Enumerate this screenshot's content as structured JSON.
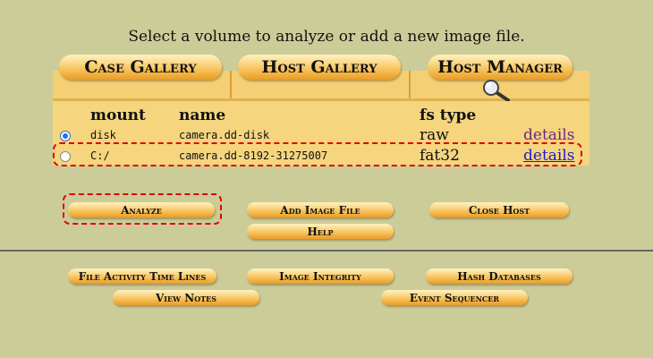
{
  "instruction": "Select a volume to analyze or add a new image file.",
  "tabs": {
    "case_gallery": "Case Gallery",
    "host_gallery": "Host Gallery",
    "host_manager": "Host Manager"
  },
  "table": {
    "headers": {
      "mount": "mount",
      "name": "name",
      "fs_type": "fs type"
    },
    "rows": [
      {
        "mount": "disk",
        "name": "camera.dd-disk",
        "fs_type": "raw",
        "details": "details",
        "selected": true
      },
      {
        "mount": "C:/",
        "name": "camera.dd-8192-31275007",
        "fs_type": "fat32",
        "details": "details",
        "selected": false
      }
    ]
  },
  "buttons": {
    "analyze": "Analyze",
    "add_image_file": "Add Image File",
    "close_host": "Close Host",
    "help": "Help"
  },
  "tools": {
    "file_activity": "File Activity Time Lines",
    "image_integrity": "Image Integrity",
    "hash_databases": "Hash Databases",
    "view_notes": "View Notes",
    "event_sequencer": "Event Sequencer"
  },
  "colors": {
    "background": "#cccc99",
    "panel": "#f6d57f",
    "highlight": "#e00000",
    "link_visited": "#6b2a7a",
    "link": "#1a1acc"
  }
}
